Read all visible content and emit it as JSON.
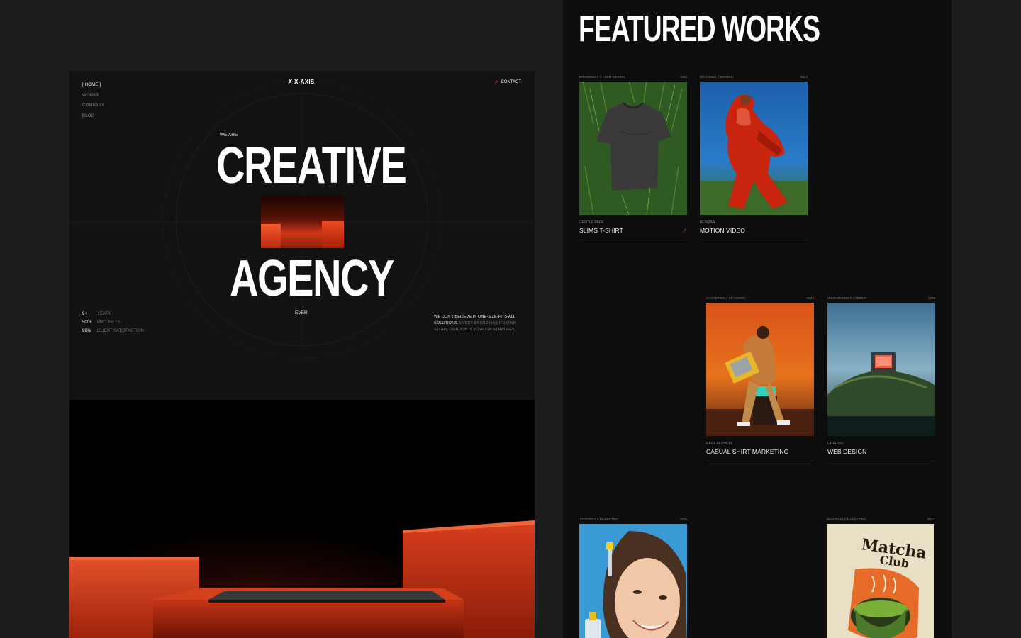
{
  "hero": {
    "nav": [
      {
        "label": "[ HOME ]",
        "active": true
      },
      {
        "label": "WORKS",
        "active": false
      },
      {
        "label": "COMPANY",
        "active": false
      },
      {
        "label": "BLOG",
        "active": false
      }
    ],
    "logo": "X-AXIS",
    "contact": "CONTACT",
    "we_are": "WE ARE",
    "headline_1": "CREATIVE",
    "headline_2": "AGENCY",
    "ever": "EVER",
    "stats": [
      {
        "num": "9+",
        "label": "YEARS"
      },
      {
        "num": "500+",
        "label": "PROJECTS"
      },
      {
        "num": "99%",
        "label": "CLIENT SATISFACTION"
      }
    ],
    "tagline_white": "WE DON'T BELIEVE IN ONE-SIZE-FITS-ALL SOLUTIONS.",
    "tagline_gray": " EVERY BRAND HAS ITS OWN STORY, OUR JOB IS TO ALIGN STRATEGY."
  },
  "works": {
    "title": "FEATURED WORKS",
    "cards": [
      {
        "category": "BRANDING // T-SHIRT DESIGN",
        "year": "2024",
        "client": "GENTLE PARK",
        "title": "SLIMS T-SHIRT",
        "arrow": "↗",
        "image": "tshirt-on-grass"
      },
      {
        "category": "BRANDING // MOTION",
        "year": "2024",
        "client": "BEINZAA",
        "title": "MOTION VIDEO",
        "arrow": "",
        "image": "red-jacket-motion"
      },
      {
        "category": "MARKETING // BRANDING",
        "year": "2023",
        "client": "EASY FASHION",
        "title": "CASUAL SHIRT MARKETING",
        "arrow": "",
        "image": "man-with-tv"
      },
      {
        "category": "UI/UX DESIGN // AGENCY",
        "year": "2023",
        "client": "ORFOLIO",
        "title": "WEB DESIGN",
        "arrow": "",
        "image": "tv-on-hill"
      },
      {
        "category": "STRATEGY // MARKETING",
        "year": "2025",
        "client": "",
        "title": "",
        "arrow": "",
        "image": "woman-serum"
      },
      {
        "category": "BRANDING // MARKETING",
        "year": "2024",
        "client": "",
        "title": "",
        "arrow": "",
        "image": "matcha-club-print"
      }
    ],
    "matcha_text": "Matcha Club"
  },
  "colors": {
    "accent": "#e8432a",
    "bg": "#1c1c1c",
    "panel": "#121212",
    "works_bg": "#0d0d0d"
  }
}
